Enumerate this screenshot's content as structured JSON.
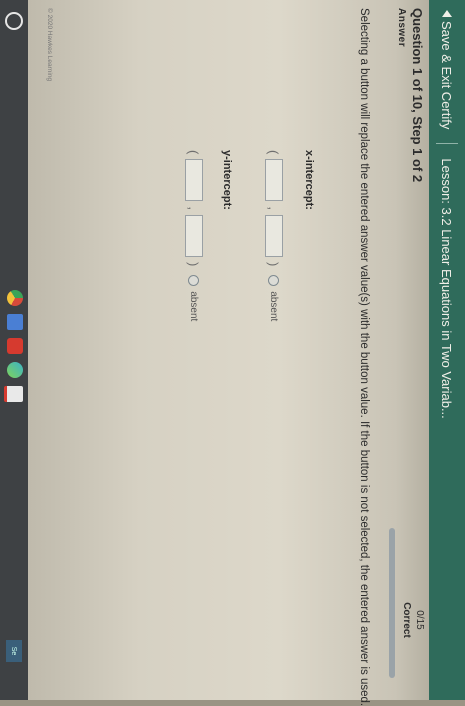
{
  "topbar": {
    "save_label": "Save & Exit Certify",
    "lesson_label": "Lesson: 3.2 Linear Equations in Two Variab..."
  },
  "question": {
    "title": "Question 1 of 10, Step 1 of 2",
    "answer_label": "Answer"
  },
  "score": {
    "value": "0/15",
    "status": "Correct",
    "progress": 0
  },
  "instruction": "Selecting a button will replace the entered answer value(s) with the button value. If the button is not selected, the entered answer is used.",
  "x_intercept": {
    "label": "x-intercept:",
    "open_paren": "(",
    "comma": ",",
    "close_paren": ")",
    "option": "absent"
  },
  "y_intercept": {
    "label": "y-intercept:",
    "open_paren": "(",
    "comma": ",",
    "close_paren": ")",
    "option": "absent"
  },
  "footer": {
    "copyright": "© 2020 Hawkes Learning"
  },
  "taskbar": {
    "right_label": "Se"
  },
  "colors": {
    "header": "#2f6b5b",
    "taskbar": "#3e4144"
  },
  "icons": [
    "back-arrow-icon",
    "launcher-icon",
    "chrome-icon",
    "docs-icon",
    "youtube-icon",
    "play-store-icon",
    "gmail-icon"
  ]
}
